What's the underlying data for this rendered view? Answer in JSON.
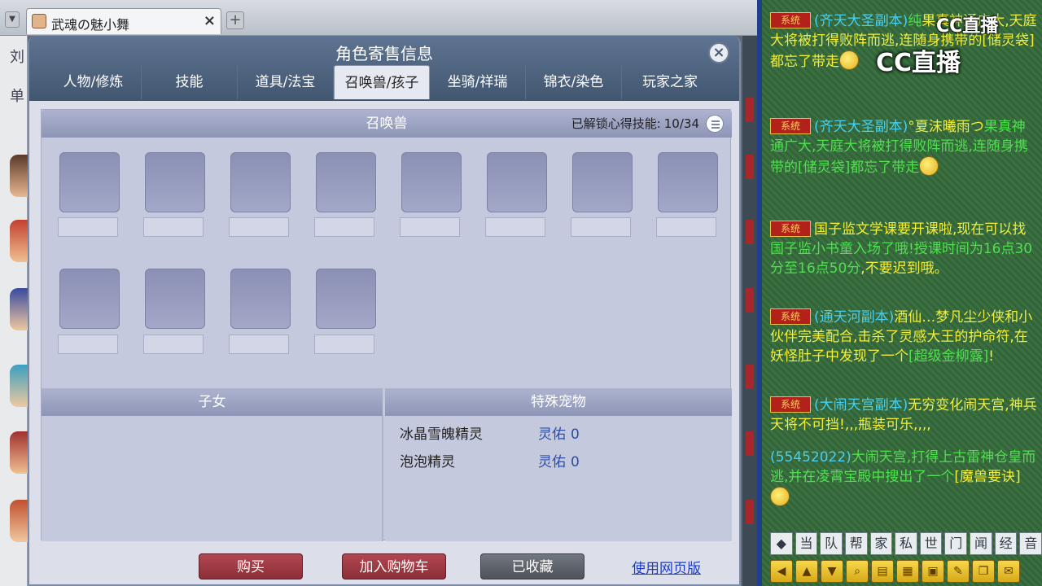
{
  "browser": {
    "tab_title": "武魂の魅小舞",
    "tab_close": "×",
    "tab_add": "+",
    "strip_text_1": "刘",
    "strip_text_2": "单"
  },
  "dialog": {
    "title": "角色寄售信息",
    "close": "×",
    "tabs": [
      {
        "label": "人物/修炼"
      },
      {
        "label": "技能"
      },
      {
        "label": "道具/法宝"
      },
      {
        "label": "召唤兽/孩子"
      },
      {
        "label": "坐骑/祥瑞"
      },
      {
        "label": "锦衣/染色"
      },
      {
        "label": "玩家之家"
      }
    ],
    "pet_section": {
      "title": "召唤兽",
      "unlock_label": "已解锁心得技能:",
      "unlock_count": "10/34"
    },
    "kids_section": {
      "title": "子女"
    },
    "special_section": {
      "title": "特殊宠物",
      "items": [
        {
          "name": "冰晶雪魄精灵",
          "bless_label": "灵佑",
          "bless_value": "0"
        },
        {
          "name": "泡泡精灵",
          "bless_label": "灵佑",
          "bless_value": "0"
        }
      ]
    },
    "buttons": {
      "buy": "购买",
      "add_cart": "加入购物车",
      "favorited": "已收藏",
      "web_version": "使用网页版"
    }
  },
  "chat": {
    "logo_small": "CC直播",
    "logo_large": "CC直播",
    "sys_label": "系统",
    "messages": [
      {
        "parts": [
          "(齐天大圣副本)",
          "纯",
          "果真神通广大,",
          "天庭大将被打得败阵而逃,连随身携带的[储灵袋]都忘了带走"
        ]
      },
      {
        "parts": [
          "(齐天大圣副本)",
          "°夏沫曦雨つ",
          "果真神通广大,天庭大将被打得败阵而逃,连随身携带的[储灵袋]都忘了带走"
        ]
      },
      {
        "parts": [
          "国子监文学课要开课啦,现在可以找",
          "国子监小书童入场了哦!授课时间为",
          "16点30分至16点50分",
          ",不要迟到哦。"
        ]
      },
      {
        "parts": [
          "(通天河副本)",
          "酒仙…梦凡尘",
          "少侠和小伙伴完美配合,击杀了灵感大王的护命符,在妖怪肚子中发现了一个",
          "[超级金柳露]",
          "!"
        ]
      },
      {
        "parts": [
          "(大闹天宫副本)",
          "无穷变化闹天宫,神兵天将不可挡!",
          ",,,瓶装可乐,,,,"
        ]
      },
      {
        "parts": [
          "(55452022)",
          "大闹天宫,打得上古雷神仓皇而逃,并在凌霄宝殿中搜出了一个",
          "[魔兽要诀]"
        ]
      }
    ],
    "channels": [
      "当",
      "队",
      "帮",
      "家",
      "私",
      "世",
      "门",
      "闻",
      "经",
      "音"
    ]
  }
}
